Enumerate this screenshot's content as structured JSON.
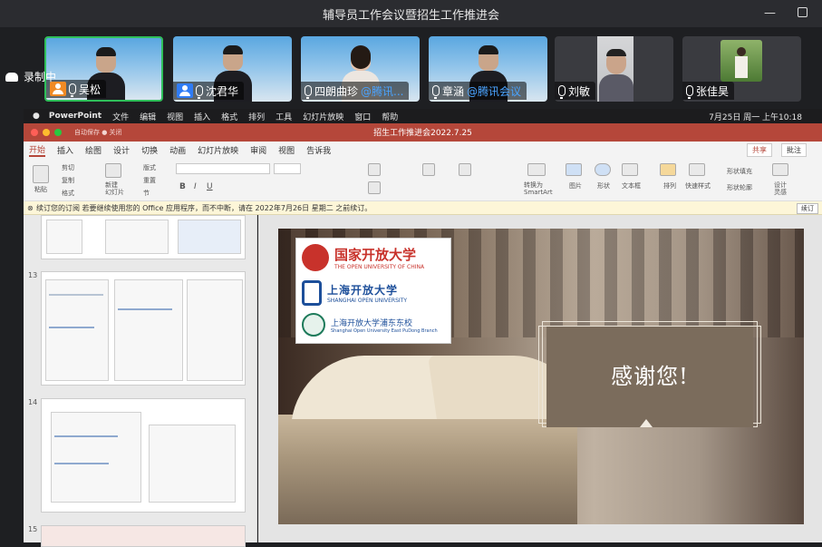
{
  "window": {
    "title": "辅导员工作会议暨招生工作推进会"
  },
  "recording": {
    "label": "录制中"
  },
  "participants": [
    {
      "name": "吴松",
      "role": "host",
      "video": true,
      "tag": ""
    },
    {
      "name": "沈君华",
      "role": "cohost",
      "video": true,
      "tag": ""
    },
    {
      "name": "四朗曲珍",
      "role": "",
      "video": true,
      "tag": "@腾讯..."
    },
    {
      "name": "章涵",
      "role": "",
      "video": true,
      "tag": "@腾讯会议"
    },
    {
      "name": "刘敏",
      "role": "",
      "video": true,
      "tag": ""
    },
    {
      "name": "张佳昊",
      "role": "",
      "video": true,
      "tag": ""
    }
  ],
  "menubar": {
    "app": "PowerPoint",
    "items": [
      "文件",
      "编辑",
      "视图",
      "插入",
      "格式",
      "排列",
      "工具",
      "幻灯片放映",
      "窗口",
      "帮助"
    ],
    "clock": "7月25日 周一 上午10:18"
  },
  "ppt": {
    "autosave": "自动保存 ● 关闭",
    "doc_title": "招生工作推进会2022.7.25",
    "tabs": [
      "开始",
      "插入",
      "绘图",
      "设计",
      "切换",
      "动画",
      "幻灯片放映",
      "审阅",
      "视图",
      "告诉我"
    ],
    "active_tab": "开始",
    "share": "共享",
    "comments": "批注",
    "ribbon_labels": {
      "paste": "粘贴",
      "cut": "剪切",
      "copy": "复制",
      "format": "格式",
      "new_slide": "新建\n幻灯片",
      "layout": "版式",
      "reset": "重置",
      "section": "节",
      "convert": "转换为\nSmartArt",
      "picture": "图片",
      "shape": "形状",
      "textbox": "文本框",
      "arrange": "排列",
      "quick_styles": "快速样式",
      "shape_fill": "形状填充",
      "shape_outline": "形状轮廓",
      "designer": "设计\n灵感"
    },
    "notice": "续订您的订阅  若要继续使用您的 Office 应用程序，而不中断，请在 2022年7月26日 星期二 之前续订。",
    "renew": "续订",
    "thumbnails": [
      {
        "num": "13"
      },
      {
        "num": "14"
      },
      {
        "num": "15"
      }
    ]
  },
  "slide": {
    "logo_lines": {
      "ouc_cn": "国家开放大学",
      "ouc_en": "THE OPEN UNIVERSITY OF CHINA",
      "sou_cn": "上海开放大学",
      "sou_en": "SHANGHAI OPEN UNIVERSITY",
      "pd_cn": "上海开放大学浦东东校",
      "pd_en": "Shanghai Open University East PuDong Branch"
    },
    "thanks": "感谢您!"
  },
  "colors": {
    "accent": "#b5473a",
    "thanks_box": "#7b6c5c",
    "host_badge": "#f08a24",
    "cohost_badge": "#2f7cf6"
  }
}
